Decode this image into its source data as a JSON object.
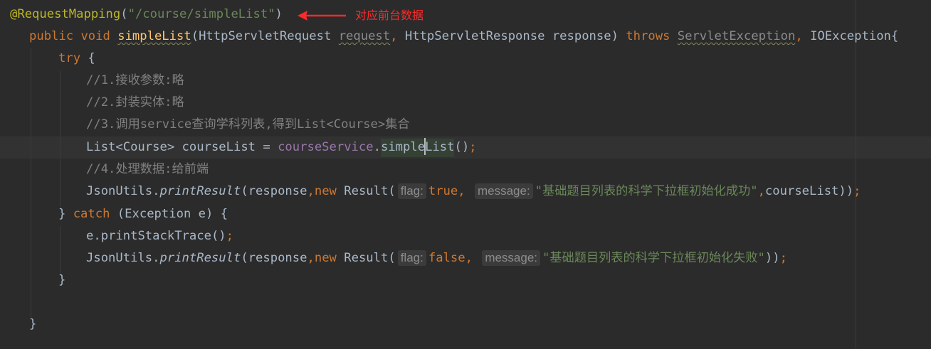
{
  "code": {
    "annotation": "@RequestMapping",
    "mapping_path": "\"/course/simpleList\"",
    "kw_public": "public",
    "kw_void": "void",
    "method_name": "simpleList",
    "param1_type": "HttpServletRequest",
    "param1_name": "request",
    "param2_type": "HttpServletResponse",
    "param2_name": "response",
    "kw_throws": "throws",
    "exception1": "ServletException",
    "exception2": "IOException",
    "kw_try": "try",
    "comment1": "//1.接收参数:略",
    "comment2": "//2.封装实体:略",
    "comment3": "//3.调用service查询学科列表,得到List<Course>集合",
    "list_type": "List<Course>",
    "var_course_list": "courseList",
    "field_course_service": "courseService",
    "call_simple": "simple",
    "call_list": "List",
    "comment4": "//4.处理数据:给前端",
    "json_utils": "JsonUtils",
    "print_result": "printResult",
    "arg_response": "response",
    "kw_new": "new",
    "result_class": "Result",
    "hint_flag": "flag:",
    "hint_message": "message:",
    "kw_true": "true",
    "kw_false": "false",
    "success_msg": "\"基础题目列表的科学下拉框初始化成功\"",
    "fail_msg": "\"基础题目列表的科学下拉框初始化失败\"",
    "kw_catch": "catch",
    "exception_type": "Exception",
    "var_e": "e",
    "print_stack": "printStackTrace"
  },
  "callout": {
    "text": "对应前台数据",
    "color": "#ff2a2a"
  },
  "theme": {
    "background": "#2b2b2b",
    "keyword": "#cc7832",
    "annotation": "#bbb529",
    "string": "#6a8759",
    "comment": "#808080",
    "field": "#9876aa",
    "method_declaration": "#ffc66d"
  }
}
